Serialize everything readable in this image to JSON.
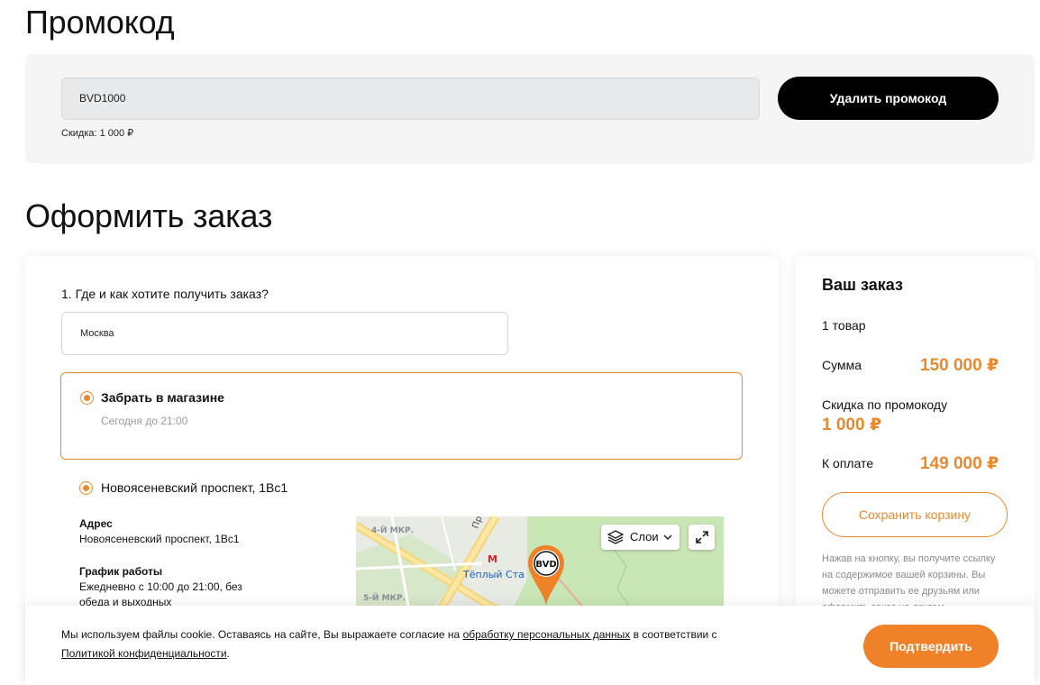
{
  "promo": {
    "title": "Промокод",
    "code_value": "BVD1000",
    "discount_text": "Скидка: 1 000 ₽",
    "remove_button": "Удалить промокод"
  },
  "order": {
    "title": "Оформить заказ",
    "step_label": "1. Где и как хотите получить заказ?",
    "city_value": "Москва",
    "pickup_option": {
      "title": "Забрать в магазине",
      "subtitle": "Сегодня до 21:00"
    },
    "store": {
      "name": "Новоясеневский проспект, 1Вс1",
      "address_label": "Адрес",
      "address_value": "Новоясеневский проспект, 1Вс1",
      "schedule_label": "График работы",
      "schedule_value_1": "Ежедневно с 10:00 до 21:00, без",
      "schedule_value_2": "обеда и выходных"
    },
    "map": {
      "layers_button": "Слои",
      "label_4mkr": "4-Й МКР.",
      "label_5mkr": "5-Й МКР.",
      "label_station": "Тёплый Ста",
      "label_road": "Про",
      "pin_logo": "BVD"
    }
  },
  "summary": {
    "title": "Ваш заказ",
    "items_count": "1 товар",
    "sum_label": "Сумма",
    "sum_value": "150 000 ₽",
    "promo_discount_label": "Скидка по промокоду",
    "promo_discount_value": "1 000 ₽",
    "to_pay_label": "К оплате",
    "to_pay_value": "149 000 ₽",
    "save_cart_button": "Сохранить корзину",
    "note_line_1": "Нажав на кнопку, вы получите ссылку",
    "note_line_2": "на содержимое вашей корзины. Вы",
    "note_line_3": "можете отправить ее друзьям или",
    "note_line_4": "оформить заказ на другом"
  },
  "cookie": {
    "text_1": "Мы используем файлы cookie. Оставаясь на сайте, Вы выражаете согласие на ",
    "link_1": "обработку персональных данных",
    "text_2": " в соответствии с ",
    "link_2": "Политикой конфиденциальности",
    "text_3": ".",
    "confirm_button": "Подтвердить"
  },
  "colors": {
    "accent": "#e8892f",
    "button_orange": "#ef8128",
    "button_black": "#000000"
  }
}
